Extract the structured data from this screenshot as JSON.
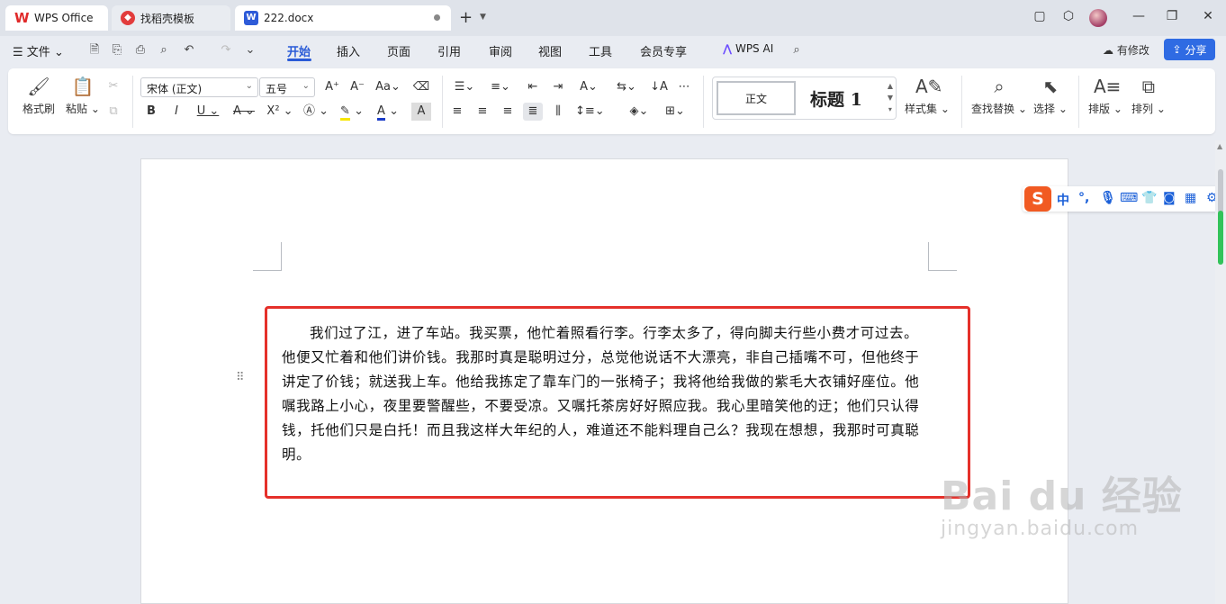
{
  "tabs": [
    {
      "label": "WPS Office",
      "icon": "wps-logo-icon"
    },
    {
      "label": "找稻壳模板",
      "icon": "docer-icon"
    },
    {
      "label": "222.docx",
      "icon": "word-doc-icon"
    }
  ],
  "menu": {
    "file": "文件",
    "items": [
      "开始",
      "插入",
      "页面",
      "引用",
      "审阅",
      "视图",
      "工具",
      "会员专享"
    ],
    "active": "开始",
    "wps_ai": "WPS AI",
    "modified": "有修改",
    "share": "分享"
  },
  "ribbon": {
    "format_painter": "格式刷",
    "paste": "粘贴",
    "font_name": "宋体 (正文)",
    "font_size": "五号",
    "style_normal": "正文",
    "style_heading": "标题 1",
    "style_set": "样式集",
    "find_replace": "查找替换",
    "select": "选择",
    "layout": "排版",
    "arrange": "排列"
  },
  "ime": {
    "mode": "中"
  },
  "document": {
    "paragraph": "我们过了江，进了车站。我买票，他忙着照看行李。行李太多了，得向脚夫行些小费才可过去。他便又忙着和他们讲价钱。我那时真是聪明过分，总觉他说话不大漂亮，非自己插嘴不可，但他终于讲定了价钱；就送我上车。他给我拣定了靠车门的一张椅子；我将他给我做的紫毛大衣铺好座位。他嘱我路上小心，夜里要警醒些，不要受凉。又嘱托茶房好好照应我。我心里暗笑他的迂；他们只认得钱，托他们只是白托！而且我这样大年纪的人，难道还不能料理自己么？我现在想想，我那时可真聪明。"
  },
  "watermark": {
    "brand": "Bai du 经验",
    "url": "jingyan.baidu.com"
  },
  "colors": {
    "accent": "#2a5bd7",
    "highlight_border": "#e5302a",
    "share_button": "#2f6be3"
  }
}
